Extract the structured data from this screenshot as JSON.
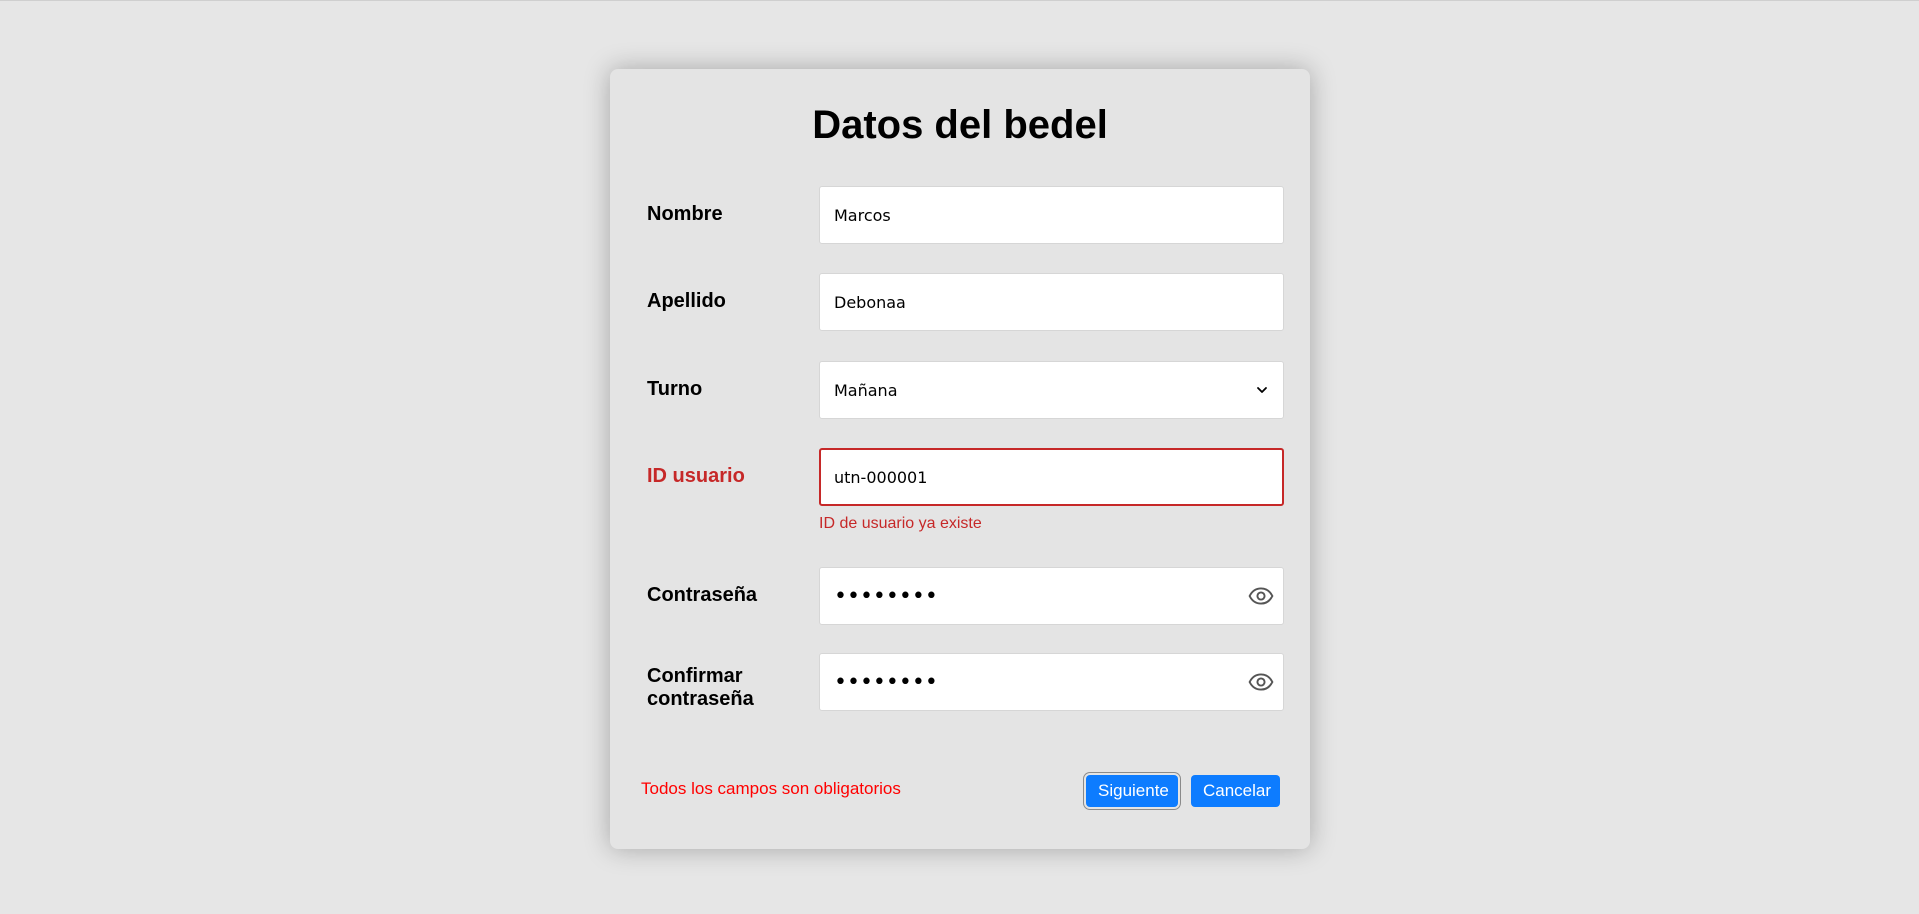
{
  "form": {
    "title": "Datos del bedel",
    "fields": {
      "nombre": {
        "label": "Nombre",
        "value": "Marcos"
      },
      "apellido": {
        "label": "Apellido",
        "value": "Debonaa"
      },
      "turno": {
        "label": "Turno",
        "value": "Mañana"
      },
      "id_usuario": {
        "label": "ID usuario",
        "value": "utn-000001",
        "error": "ID de usuario ya existe"
      },
      "contrasena": {
        "label": "Contraseña",
        "value": "••••••••"
      },
      "confirmar": {
        "label_line1": "Confirmar",
        "label_line2": "contraseña",
        "value": "••••••••"
      }
    },
    "required_note": "Todos los campos son obligatorios",
    "buttons": {
      "next": "Siguiente",
      "cancel": "Cancelar"
    }
  },
  "icons": {
    "password_toggle": "eye-icon",
    "select": "chevron-down-icon"
  },
  "colors": {
    "background": "#e6e6e6",
    "card": "#e4e4e4",
    "error": "#c62828",
    "required_note": "#ff0000",
    "button": "#0d7cff"
  }
}
